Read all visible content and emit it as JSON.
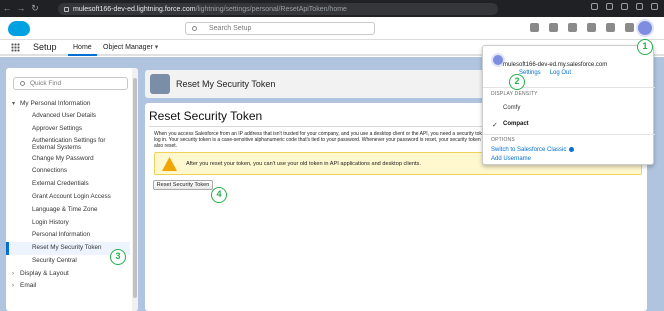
{
  "browser": {
    "url_host": "mulesoft166-dev-ed.lightning.force.com",
    "url_path": "/lightning/settings/personal/ResetApiToken/home"
  },
  "header": {
    "search_placeholder": "Search Setup"
  },
  "appnav": {
    "app_name": "Setup",
    "tabs": [
      "Home",
      "Object Manager"
    ]
  },
  "sidebar": {
    "quick_find_placeholder": "Quick Find",
    "section_personal": "My Personal Information",
    "items": [
      "Advanced User Details",
      "Approver Settings",
      "Authentication Settings for External Systems",
      "Change My Password",
      "Connections",
      "External Credentials",
      "Grant Account Login Access",
      "Language & Time Zone",
      "Login History",
      "Personal Information",
      "Reset My Security Token",
      "Security Central"
    ],
    "section_display": "Display & Layout",
    "section_email": "Email"
  },
  "page_header": {
    "title": "Reset My Security Token"
  },
  "content": {
    "heading": "Reset Security Token",
    "description": "When you access Salesforce from an IP address that isn't trusted for your company, and you use a desktop client or the API, you need a security token to log in. Your security token is a case-sensitive alphanumeric code that's tied to your password. Whenever your password is reset, your security token is also reset.",
    "warning": "After you reset your token, you can't use your old token in API applications and desktop clients.",
    "reset_button": "Reset Security Token"
  },
  "dropdown": {
    "username": "mulesoft166-dev-ed.my.salesforce.com",
    "settings_link": "Settings",
    "logout_link": "Log Out",
    "density_label": "DISPLAY DENSITY",
    "density_comfy": "Comfy",
    "density_compact": "Compact",
    "options_label": "OPTIONS",
    "switch_classic": "Switch to Salesforce Classic",
    "add_username": "Add Username"
  },
  "badges": {
    "step1": "1",
    "step2": "2",
    "step3": "3",
    "step4": "4"
  },
  "colors": {
    "brand_blue": "#00a1e0",
    "link_blue": "#0070d2",
    "badge_green": "#22b14c",
    "warning_bg": "#fff7cd",
    "page_bg": "#b0c4df"
  }
}
